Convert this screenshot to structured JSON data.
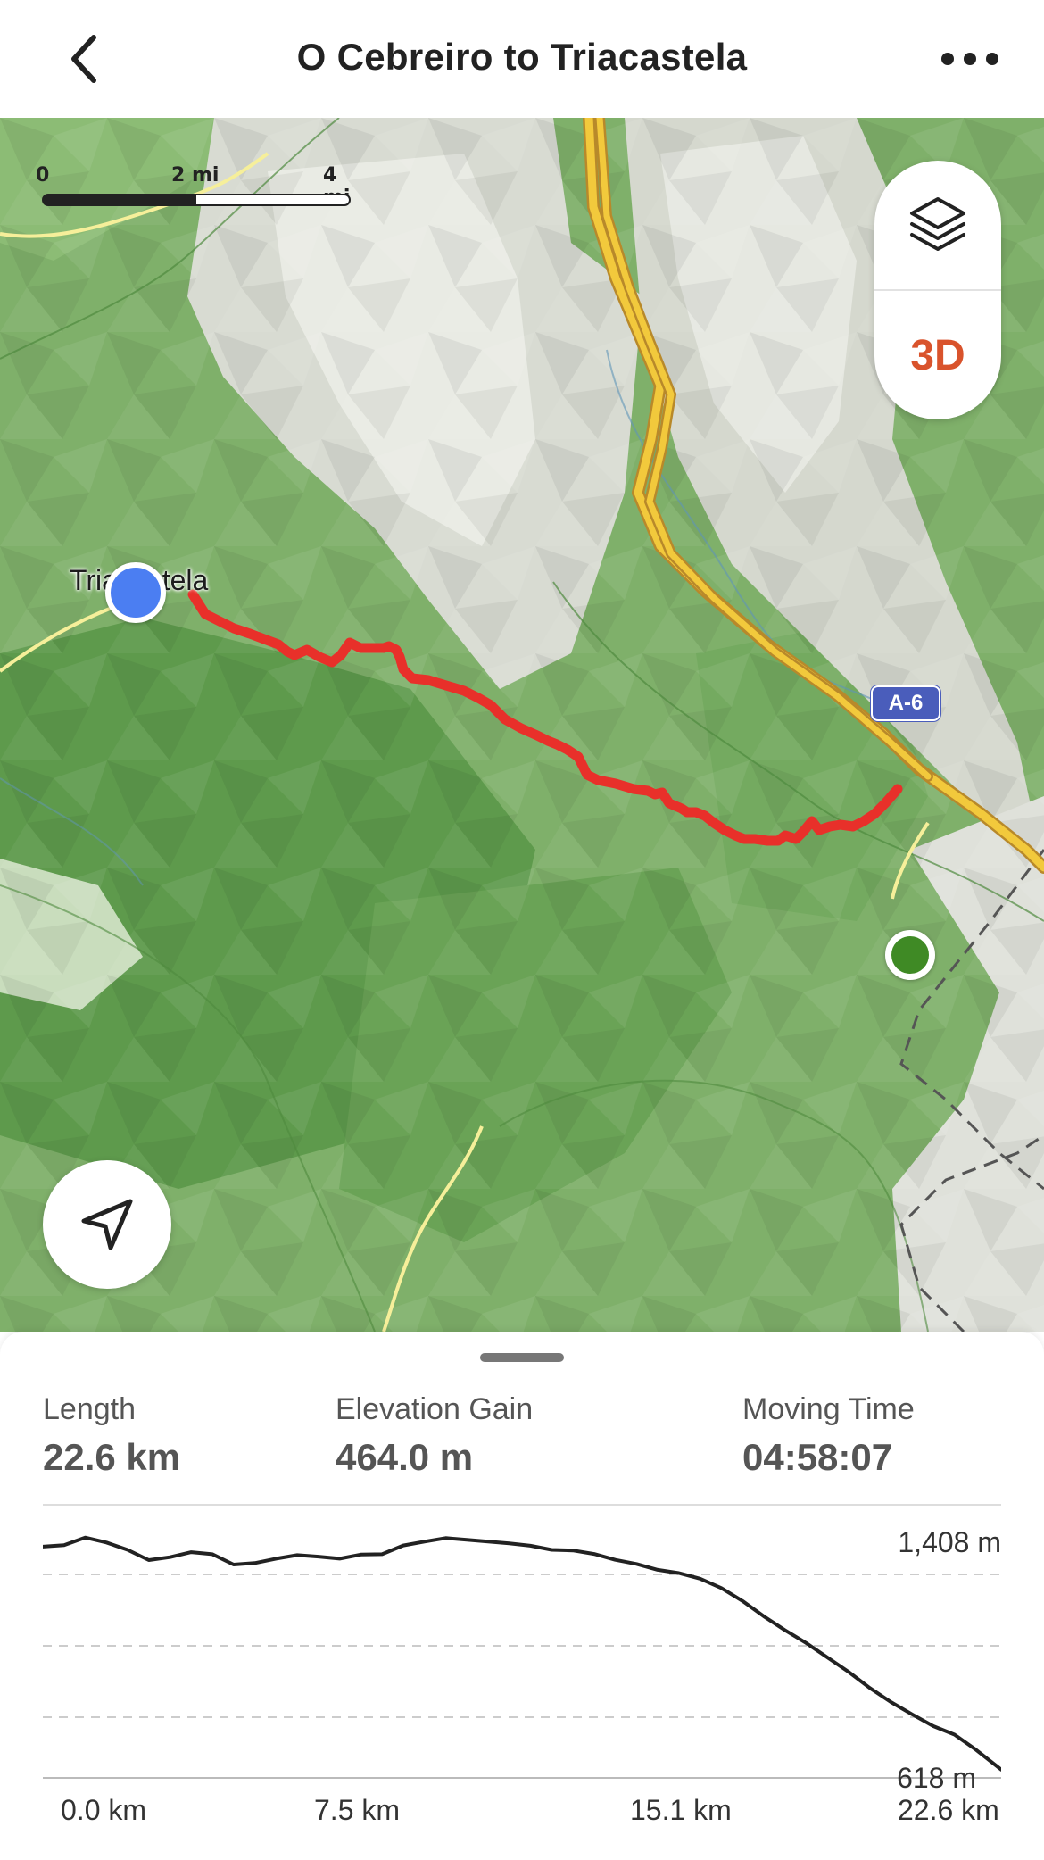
{
  "header": {
    "title": "O Cebreiro to Triacastela",
    "back_icon": "chevron-left-icon",
    "more_icon": "more-horizontal-icon"
  },
  "map": {
    "scale": {
      "ticks": [
        "0",
        "2 mi",
        "4 mi"
      ]
    },
    "layers_icon": "layers-icon",
    "btn_3d": "3D",
    "locate_icon": "navigation-arrow-icon",
    "place_label": "Triacastela",
    "road_shield": "A-6",
    "colors": {
      "route": "#e8302a",
      "start": "#4b7ef2",
      "end": "#3f8a25",
      "three_d": "#d9532c",
      "terrain": "#7fb06a"
    }
  },
  "stats": {
    "length": {
      "label": "Length",
      "value": "22.6 km"
    },
    "elevation_gain": {
      "label": "Elevation Gain",
      "value": "464.0 m"
    },
    "moving_time": {
      "label": "Moving Time",
      "value": "04:58:07"
    }
  },
  "elevation_profile": {
    "y_max_label": "1,408 m",
    "y_min_label": "618 m",
    "x_labels": [
      "0.0 km",
      "7.5 km",
      "15.1 km",
      "22.6 km"
    ]
  },
  "chart_data": {
    "type": "line",
    "title": "",
    "xlabel": "",
    "ylabel": "",
    "x_unit": "km",
    "y_unit": "m",
    "xlim": [
      0,
      22.6
    ],
    "ylim": [
      618,
      1408
    ],
    "x": [
      0,
      0.5,
      1.0,
      1.5,
      2.0,
      2.5,
      3.0,
      3.5,
      4.0,
      4.5,
      5.0,
      5.5,
      6.0,
      6.5,
      7.0,
      7.5,
      8.0,
      8.5,
      9.0,
      9.5,
      10.0,
      10.5,
      11.0,
      11.5,
      12.0,
      12.5,
      13.0,
      13.5,
      14.0,
      14.5,
      15.0,
      15.5,
      16.0,
      16.5,
      17.0,
      17.5,
      18.0,
      18.5,
      19.0,
      19.5,
      20.0,
      20.5,
      21.0,
      21.5,
      22.0,
      22.6
    ],
    "y": [
      1381,
      1386,
      1412,
      1395,
      1370,
      1335,
      1345,
      1362,
      1355,
      1320,
      1325,
      1340,
      1352,
      1347,
      1340,
      1354,
      1355,
      1385,
      1398,
      1410,
      1404,
      1398,
      1392,
      1384,
      1370,
      1368,
      1356,
      1336,
      1322,
      1302,
      1291,
      1272,
      1240,
      1196,
      1144,
      1097,
      1053,
      1004,
      955,
      900,
      852,
      810,
      770,
      741,
      690,
      622
    ]
  }
}
